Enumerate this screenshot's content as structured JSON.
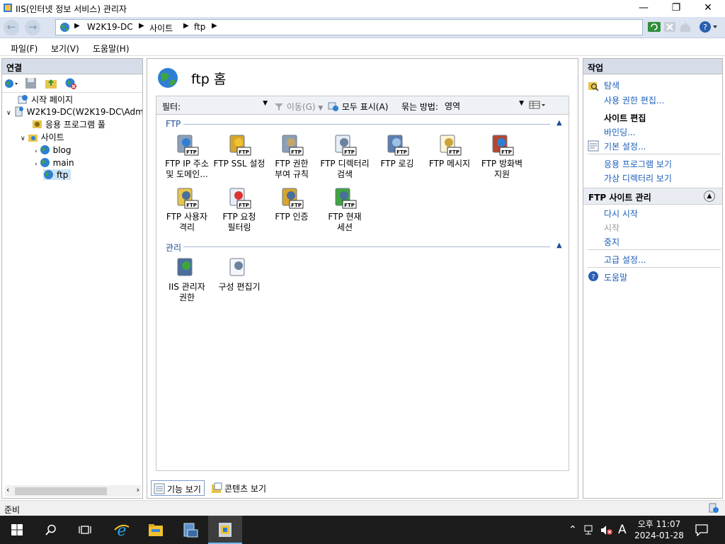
{
  "window": {
    "title": "IIS(인터넷 정보 서비스) 관리자"
  },
  "address": {
    "crumbs": [
      "W2K19-DC",
      "사이트",
      "ftp"
    ]
  },
  "menu": [
    "파일(F)",
    "보기(V)",
    "도움말(H)"
  ],
  "connections": {
    "header": "연결",
    "tree": {
      "start_page": "시작 페이지",
      "server": "W2K19-DC(W2K19-DC\\Adm",
      "app_pools": "응용 프로그램 풀",
      "sites": "사이트",
      "blog": "blog",
      "main": "main",
      "ftp": "ftp"
    }
  },
  "center": {
    "title": "ftp 홈",
    "filter": {
      "label": "필터:",
      "go": "이동(G)",
      "show_all": "모두 표시(A)",
      "group_by_label": "묶는 방법:",
      "group_by_value": "영역"
    },
    "groups": {
      "ftp": "FTP",
      "manage": "관리"
    },
    "ftp_features": [
      [
        "FTP IP 주소",
        "및 도메인..."
      ],
      [
        "FTP SSL 설정",
        ""
      ],
      [
        "FTP 권한",
        "부여 규칙"
      ],
      [
        "FTP 디렉터리",
        "검색"
      ],
      [
        "FTP 로깅",
        ""
      ],
      [
        "FTP 메시지",
        ""
      ],
      [
        "FTP 방화벽",
        "지원"
      ],
      [
        "FTP 사용자",
        "격리"
      ],
      [
        "FTP 요청",
        "필터링"
      ],
      [
        "FTP 인증",
        ""
      ],
      [
        "FTP 현재",
        "세션"
      ]
    ],
    "manage_features": [
      [
        "IIS 관리자",
        "권한"
      ],
      [
        "구성 편집기",
        ""
      ]
    ]
  },
  "bottom_tabs": {
    "features": "기능 보기",
    "content": "콘텐츠 보기"
  },
  "actions": {
    "header": "작업",
    "explore": "탐색",
    "edit_permissions": "사용 권한 편집...",
    "edit_site_head": "사이트 편집",
    "bindings": "바인딩...",
    "basic_settings": "기본 설정...",
    "view_apps": "응용 프로그램 보기",
    "view_vdirs": "가상 디렉터리 보기",
    "ftp_manage_head": "FTP 사이트 관리",
    "restart": "다시 시작",
    "start": "시작",
    "stop": "중지",
    "advanced": "고급 설정...",
    "help": "도움말"
  },
  "status": {
    "text": "준비"
  },
  "taskbar": {
    "time": "오후 11:07",
    "date": "2024-01-28",
    "ime": "A"
  }
}
